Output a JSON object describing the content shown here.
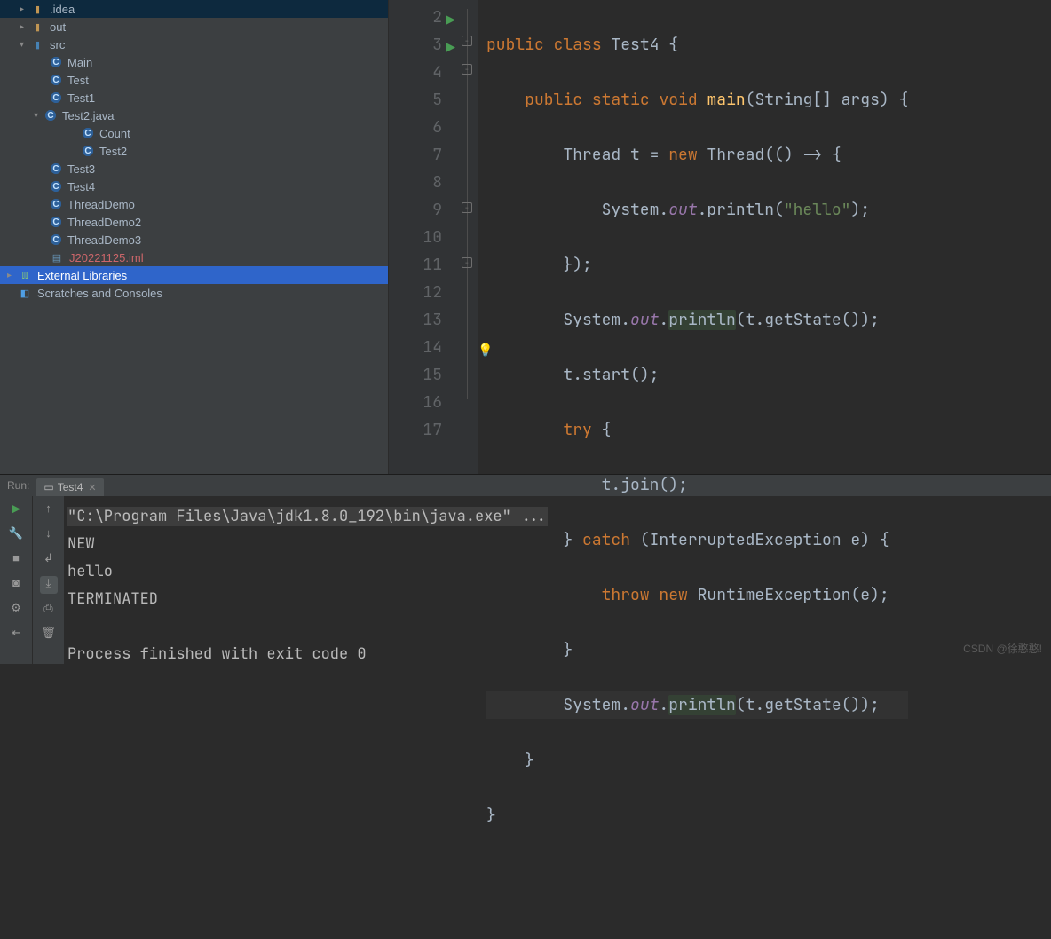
{
  "tree": {
    "idea": ".idea",
    "out": "out",
    "src": "src",
    "main": "Main",
    "test": "Test",
    "test1": "Test1",
    "test2java": "Test2.java",
    "count": "Count",
    "test2": "Test2",
    "test3": "Test3",
    "test4": "Test4",
    "threaddemo": "ThreadDemo",
    "threaddemo2": "ThreadDemo2",
    "threaddemo3": "ThreadDemo3",
    "iml": "J20221125.iml",
    "extlib": "External Libraries",
    "scratch": "Scratches and Consoles"
  },
  "gutter": [
    "2",
    "3",
    "4",
    "5",
    "6",
    "7",
    "8",
    "9",
    "10",
    "11",
    "12",
    "13",
    "14",
    "15",
    "16",
    "17"
  ],
  "code": {
    "l2": {
      "kw1": "public",
      "kw2": "class",
      "name": " Test4 {"
    },
    "l3": {
      "kw1": "public",
      "kw2": "static",
      "kw3": "void",
      "m": "main",
      "rest": "(String[] args) {"
    },
    "l4": {
      "a": "Thread t = ",
      "kw": "new",
      "b": " Thread(() -> {"
    },
    "l5": {
      "a": "System.",
      "f": "out",
      "b": ".println(",
      "s": "\"hello\"",
      "c": ");"
    },
    "l6": "});",
    "l7": {
      "a": "System.",
      "f": "out",
      "b": ".",
      "m": "println",
      "c": "(t.getState());"
    },
    "l8": "t.start();",
    "l9": {
      "kw": "try",
      "b": " {"
    },
    "l10": "t.join();",
    "l11": {
      "a": "} ",
      "kw": "catch",
      "b": " (InterruptedException e) {"
    },
    "l12": {
      "kw1": "throw",
      "kw2": "new",
      "b": " RuntimeException(e);"
    },
    "l13": "}",
    "l14": {
      "a": "System.",
      "f": "out",
      "b": ".",
      "m": "println",
      "c": "(t.getState());"
    },
    "l15": "}",
    "l16": "}"
  },
  "run": {
    "label": "Run:",
    "tab": "Test4",
    "cmd": "\"C:\\Program Files\\Java\\jdk1.8.0_192\\bin\\java.exe\" ...",
    "out1": "NEW",
    "out2": "hello",
    "out3": "TERMINATED",
    "exit": "Process finished with exit code 0"
  },
  "watermark": "CSDN @徐憨憨!"
}
